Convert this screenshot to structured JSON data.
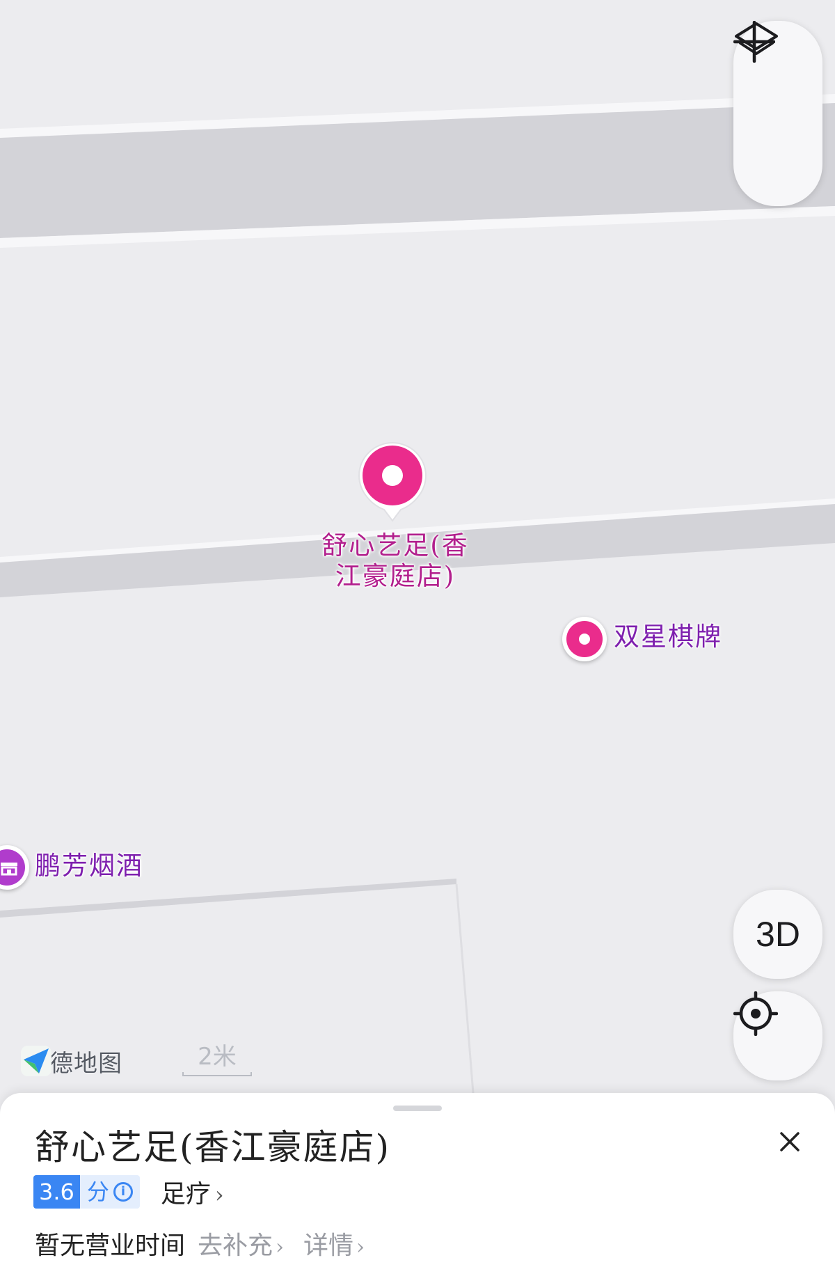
{
  "map": {
    "pois": [
      {
        "name": "舒心艺足(香江豪庭店)",
        "line1": "舒心艺足(香",
        "line2": "江豪庭店)"
      },
      {
        "name": "双星棋牌"
      },
      {
        "name": "鹏芳烟酒"
      }
    ],
    "brand": "高德地图",
    "scale_label": "2米"
  },
  "controls": {
    "zoom_in": "zoom-in",
    "layers": "layers",
    "three_d_label": "3D",
    "locate": "locate"
  },
  "sheet": {
    "title": "舒心艺足(香江豪庭店)",
    "score": "3.6",
    "score_unit": "分",
    "category": "足疗",
    "hours": "暂无营业时间",
    "supplement_link": "去补充",
    "details_link": "详情"
  },
  "colors": {
    "poi_pink": "#ea2c8c",
    "label_magenta": "#b21f8d",
    "label_purple": "#7e1fae",
    "score_blue": "#3a86f3"
  }
}
